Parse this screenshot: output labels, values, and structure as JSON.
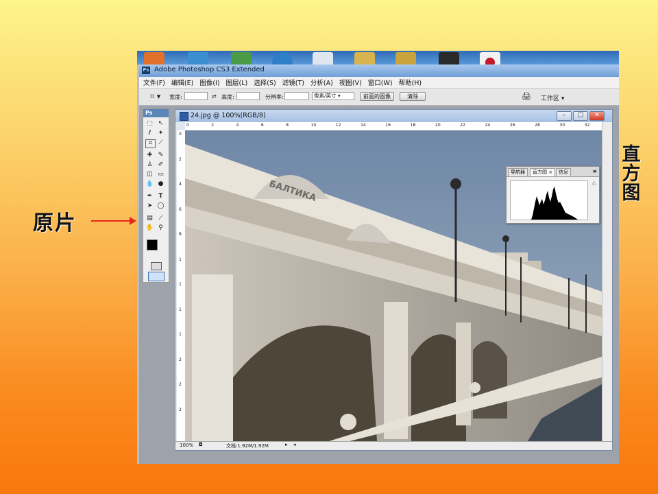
{
  "slide": {
    "left_label": "原片",
    "right_label": "直方图"
  },
  "app": {
    "title": "Adobe Photoshop CS3 Extended",
    "ps_badge": "Ps"
  },
  "menu": {
    "items": [
      "文件(F)",
      "编辑(E)",
      "图像(I)",
      "图层(L)",
      "选择(S)",
      "滤镜(T)",
      "分析(A)",
      "视图(V)",
      "窗口(W)",
      "帮助(H)"
    ]
  },
  "options": {
    "width_label": "宽度:",
    "height_label": "高度:",
    "resolution_label": "分辨率:",
    "unit_value": "像素/英寸",
    "front_image_button": "前面的图像",
    "clear_button": "清除",
    "workspace_label": "工作区 ▾"
  },
  "toolbox": {
    "header": "Ps"
  },
  "document": {
    "title": "24.jpg @ 100%(RGB/8)",
    "zoom": "100%",
    "doc_size": "文档:1.92M/1.92M",
    "ruler_top_labels": [
      "0",
      "2",
      "4",
      "6",
      "8",
      "10",
      "12",
      "14",
      "16",
      "18",
      "20",
      "22",
      "24",
      "26",
      "28",
      "30",
      "32"
    ],
    "ruler_left_labels": [
      "0",
      "2",
      "4",
      "6",
      "8",
      "1",
      "1",
      "1",
      "1",
      "2",
      "2",
      "2"
    ],
    "sign_text": "БАЛТИКА"
  },
  "histogram_panel": {
    "tabs": [
      "导航器",
      "直方图",
      "信息"
    ],
    "active_tab": "直方图",
    "close_glyph": "×"
  },
  "colors": {
    "accent_arrow": "#e5281a",
    "foreground": "#000000",
    "background": "#ffffff"
  }
}
